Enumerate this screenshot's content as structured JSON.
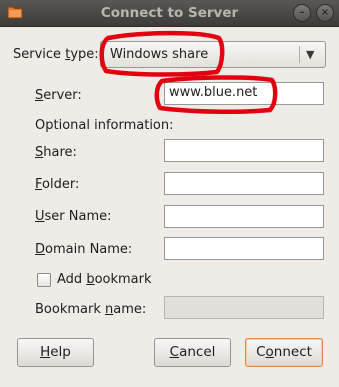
{
  "window": {
    "title": "Connect to Server",
    "folder_icon": "folder-icon",
    "minimize_glyph": "–",
    "close_glyph": "×"
  },
  "service": {
    "label_pre": "S",
    "label_mid": "ervice ",
    "label_key": "t",
    "label_post": "ype:",
    "value": "Windows share",
    "arrow": "▼"
  },
  "fields": {
    "server_label": "Server:",
    "server_key": "S",
    "server_rest": "erver:",
    "server_value": "www.blue.net",
    "optional_heading": "Optional information:",
    "share_key": "S",
    "share_rest": "hare:",
    "folder_key": "F",
    "folder_rest": "older:",
    "username_key": "U",
    "username_rest": "ser Name:",
    "domain_key": "D",
    "domain_rest": "omain Name:",
    "share_value": "",
    "folder_value": "",
    "username_value": "",
    "domain_value": ""
  },
  "bookmark": {
    "checkbox_pre": "Add ",
    "checkbox_key": "b",
    "checkbox_post": "ookmark",
    "name_pre": "Bookmark ",
    "name_key": "n",
    "name_post": "ame:",
    "checked": false
  },
  "buttons": {
    "help_key": "H",
    "help_rest": "elp",
    "cancel_key": "C",
    "cancel_rest": "ancel",
    "connect_pre": "C",
    "connect_key": "o",
    "connect_post": "nnect"
  },
  "colors": {
    "annotation_red": "#e3000f",
    "default_button_border": "#e0884e"
  }
}
